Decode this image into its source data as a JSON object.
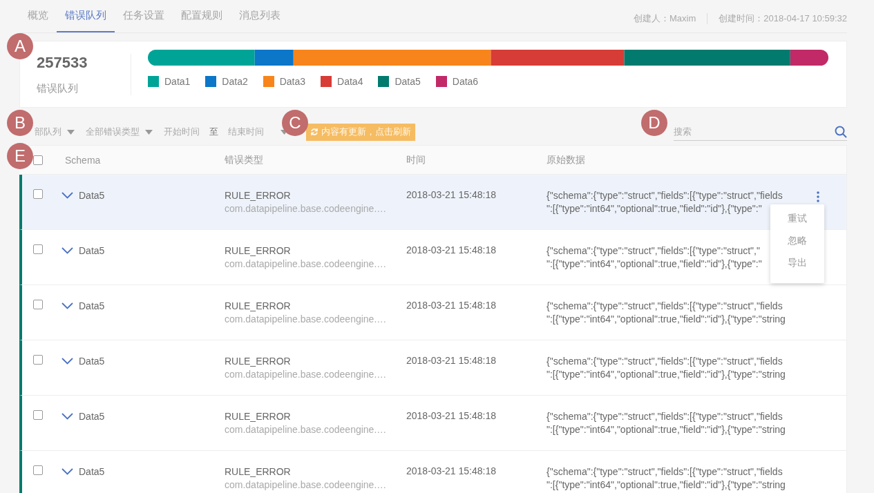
{
  "tabs": [
    {
      "label": "概览",
      "selected": false
    },
    {
      "label": "错误队列",
      "selected": true
    },
    {
      "label": "任务设置",
      "selected": false
    },
    {
      "label": "配置规则",
      "selected": false
    },
    {
      "label": "消息列表",
      "selected": false
    }
  ],
  "meta": {
    "creator_label": "创建人：",
    "creator": "Maxim",
    "created_label": "创建时间：",
    "created": "2018-04-17 10:59:32"
  },
  "summary": {
    "count": "257533",
    "label": "错误队列",
    "segments": [
      {
        "name": "Data1",
        "color": "#00a497"
      },
      {
        "name": "Data2",
        "color": "#0c76c8"
      },
      {
        "name": "Data3",
        "color": "#f7851b"
      },
      {
        "name": "Data4",
        "color": "#d73c36"
      },
      {
        "name": "Data5",
        "color": "#027b6e"
      },
      {
        "name": "Data6",
        "color": "#c12a67"
      }
    ]
  },
  "filters": {
    "queue": "部队列",
    "error_type": "全部错误类型",
    "start": "开始时间",
    "to": "至",
    "end": "结束时间",
    "refresh": "内容有更新，点击刷新",
    "search_placeholder": "搜索"
  },
  "table": {
    "select_all": {
      "checked": false
    },
    "columns": [
      "Schema",
      "错误类型",
      "时间",
      "原始数据"
    ],
    "rows": [
      {
        "schema": "Data5",
        "error": "RULE_ERROR",
        "detail": "com.datapipeline.base.codeengine.…",
        "time": "2018-03-21 15:48:18",
        "raw": [
          "{\"schema\":{\"type\":\"struct\",\"fields\":[{\"type\":\"struct\",\"fields",
          "\":[{\"type\":\"int64\",\"optional\":true,\"field\":\"id\"},{\"type\":\""
        ],
        "checked": false,
        "highlighted": true,
        "menu": [
          "重试",
          "忽略",
          "导出"
        ]
      },
      {
        "schema": "Data5",
        "error": "RULE_ERROR",
        "detail": "com.datapipeline.base.codeengine.…",
        "time": "2018-03-21 15:48:18",
        "raw": [
          "{\"schema\":{\"type\":\"struct\",\"fields\":[{\"type\":\"struct\",\"",
          "\":[{\"type\":\"int64\",\"optional\":true,\"field\":\"id\"},{\"type\":\""
        ],
        "checked": false,
        "highlighted": false
      },
      {
        "schema": "Data5",
        "error": "RULE_ERROR",
        "detail": "com.datapipeline.base.codeengine.…",
        "time": "2018-03-21 15:48:18",
        "raw": [
          "{\"schema\":{\"type\":\"struct\",\"fields\":[{\"type\":\"struct\",\"fields",
          "\":[{\"type\":\"int64\",\"optional\":true,\"field\":\"id\"},{\"type\":\"string"
        ],
        "checked": false,
        "highlighted": false
      },
      {
        "schema": "Data5",
        "error": "RULE_ERROR",
        "detail": "com.datapipeline.base.codeengine.…",
        "time": "2018-03-21 15:48:18",
        "raw": [
          "{\"schema\":{\"type\":\"struct\",\"fields\":[{\"type\":\"struct\",\"fields",
          "\":[{\"type\":\"int64\",\"optional\":true,\"field\":\"id\"},{\"type\":\"string"
        ],
        "checked": false,
        "highlighted": false
      },
      {
        "schema": "Data5",
        "error": "RULE_ERROR",
        "detail": "com.datapipeline.base.codeengine.…",
        "time": "2018-03-21 15:48:18",
        "raw": [
          "{\"schema\":{\"type\":\"struct\",\"fields\":[{\"type\":\"struct\",\"fields",
          "\":[{\"type\":\"int64\",\"optional\":true,\"field\":\"id\"},{\"type\":\"string"
        ],
        "checked": false,
        "highlighted": false
      },
      {
        "schema": "Data5",
        "error": "RULE_ERROR",
        "detail": "com.datapipeline.base.codeengine.…",
        "time": "2018-03-21 15:48:18",
        "raw": [
          "{\"schema\":{\"type\":\"struct\",\"fields\":[{\"type\":\"struct\",\"fields",
          "\":[{\"type\":\"int64\",\"optional\":true,\"field\":\"id\"},{\"type\":\"string"
        ],
        "checked": false,
        "highlighted": false
      }
    ]
  },
  "annotations": [
    {
      "label": "A"
    },
    {
      "label": "B"
    },
    {
      "label": "C"
    },
    {
      "label": "D"
    },
    {
      "label": "E"
    }
  ]
}
